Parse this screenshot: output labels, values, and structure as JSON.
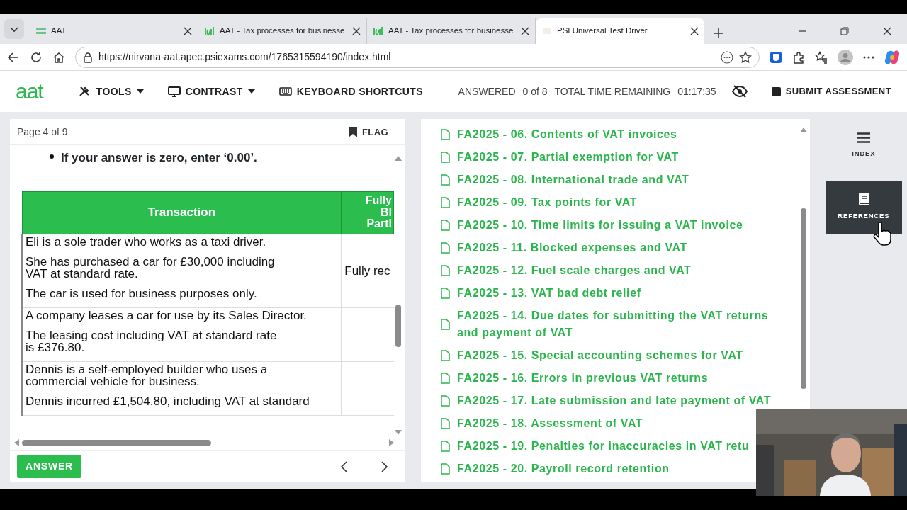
{
  "browser": {
    "tabs": [
      {
        "title": "AAT",
        "selected": false
      },
      {
        "title": "AAT - Tax processes for businesse",
        "selected": false
      },
      {
        "title": "AAT - Tax processes for businesse",
        "selected": false
      },
      {
        "title": "PSI Universal Test Driver",
        "selected": true
      }
    ],
    "url": "https://nirvana-aat.apec.psiexams.com/1765315594190/index.html"
  },
  "header": {
    "logo": "aat",
    "menus": [
      {
        "label": "TOOLS",
        "kind": "dropdown"
      },
      {
        "label": "CONTRAST",
        "kind": "dropdown"
      },
      {
        "label": "KEYBOARD SHORTCUTS",
        "kind": "plain"
      }
    ],
    "answered_label": "ANSWERED",
    "answered_value": "0 of 8",
    "time_label": "TOTAL TIME REMAINING",
    "time_value": "01:17:35",
    "submit": "SUBMIT ASSESSMENT"
  },
  "question": {
    "page": "Page 4 of 9",
    "flag": "FLAG",
    "bullets": [
      "If your answer is zero, enter ‘0.00’."
    ],
    "table": {
      "columns": [
        "Transaction",
        "Fully\nBl\nPartl"
      ],
      "rows": [
        {
          "transaction": [
            "Eli is a sole trader who works as a taxi driver.",
            "She has purchased a car for £30,000 including\nVAT at standard rate.",
            "The car is used for business purposes only."
          ],
          "column_2": "Fully rec"
        },
        {
          "transaction": [
            "A company leases a car for use by its Sales Director.",
            "The leasing cost including VAT at standard rate\nis £376.80."
          ]
        },
        {
          "transaction": [
            "Dennis is a self-employed builder who uses a\ncommercial vehicle for business.",
            "Dennis incurred £1,504.80, including VAT at standard"
          ]
        }
      ]
    },
    "answer_button": "ANSWER"
  },
  "references": {
    "items": [
      "FA2025 - 06. Contents of VAT invoices",
      "FA2025 - 07. Partial exemption for VAT",
      "FA2025 - 08. International trade and VAT",
      "FA2025 - 09. Tax points for VAT",
      "FA2025 - 10. Time limits for issuing a VAT invoice",
      "FA2025 - 11. Blocked expenses and VAT",
      "FA2025 - 12. Fuel scale charges and VAT",
      "FA2025 - 13. VAT bad debt relief",
      "FA2025 - 14. Due dates for submitting the VAT returns and payment of VAT",
      "FA2025 - 15. Special accounting schemes for VAT",
      "FA2025 - 16. Errors in previous VAT returns",
      "FA2025 - 17. Late submission and late payment of VAT",
      "FA2025 - 18. Assessment of VAT",
      "FA2025 - 19. Penalties for inaccuracies in VAT retu",
      "FA2025 - 20. Payroll record retention"
    ]
  },
  "sidebar": [
    {
      "label": "INDEX",
      "selected": false
    },
    {
      "label": "REFERENCES",
      "selected": true
    }
  ]
}
